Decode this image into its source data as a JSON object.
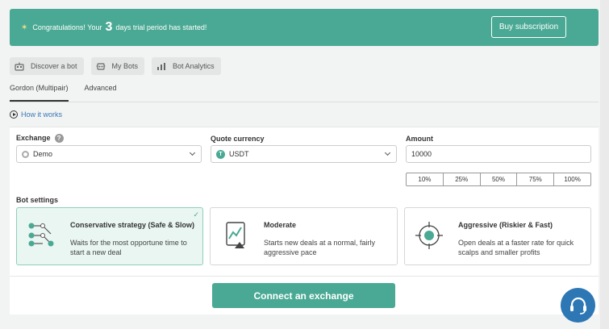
{
  "banner": {
    "prefix": "Congratulations! Your",
    "days": "3",
    "suffix": "days trial period has started!",
    "buy_label": "Buy subscription"
  },
  "nav": [
    {
      "label": "Discover a bot",
      "icon": "bot-icon"
    },
    {
      "label": "My Bots",
      "icon": "robot-icon"
    },
    {
      "label": "Bot Analytics",
      "icon": "analytics-icon"
    }
  ],
  "tabs": [
    {
      "label": "Gordon (Multipair)",
      "active": true
    },
    {
      "label": "Advanced",
      "active": false
    }
  ],
  "how_it_works": "How it works",
  "form": {
    "exchange_label": "Exchange",
    "exchange_value": "Demo",
    "quote_label": "Quote currency",
    "quote_value": "USDT",
    "quote_icon_text": "T",
    "amount_label": "Amount",
    "amount_value": "10000",
    "percents": [
      "10%",
      "25%",
      "50%",
      "75%",
      "100%"
    ]
  },
  "bot_settings": {
    "label": "Bot settings",
    "cards": [
      {
        "title": "Conservative strategy (Safe & Slow)",
        "desc": "Waits for the most opportune time to start a new deal",
        "selected": true
      },
      {
        "title": "Moderate",
        "desc": "Starts new deals at a normal, fairly aggressive pace",
        "selected": false
      },
      {
        "title": "Aggressive (Riskier & Fast)",
        "desc": "Open deals at a faster rate for quick scalps and smaller profits",
        "selected": false
      }
    ]
  },
  "connect_label": "Connect an exchange",
  "colors": {
    "accent": "#4aa994",
    "chat": "#2d77b5"
  }
}
